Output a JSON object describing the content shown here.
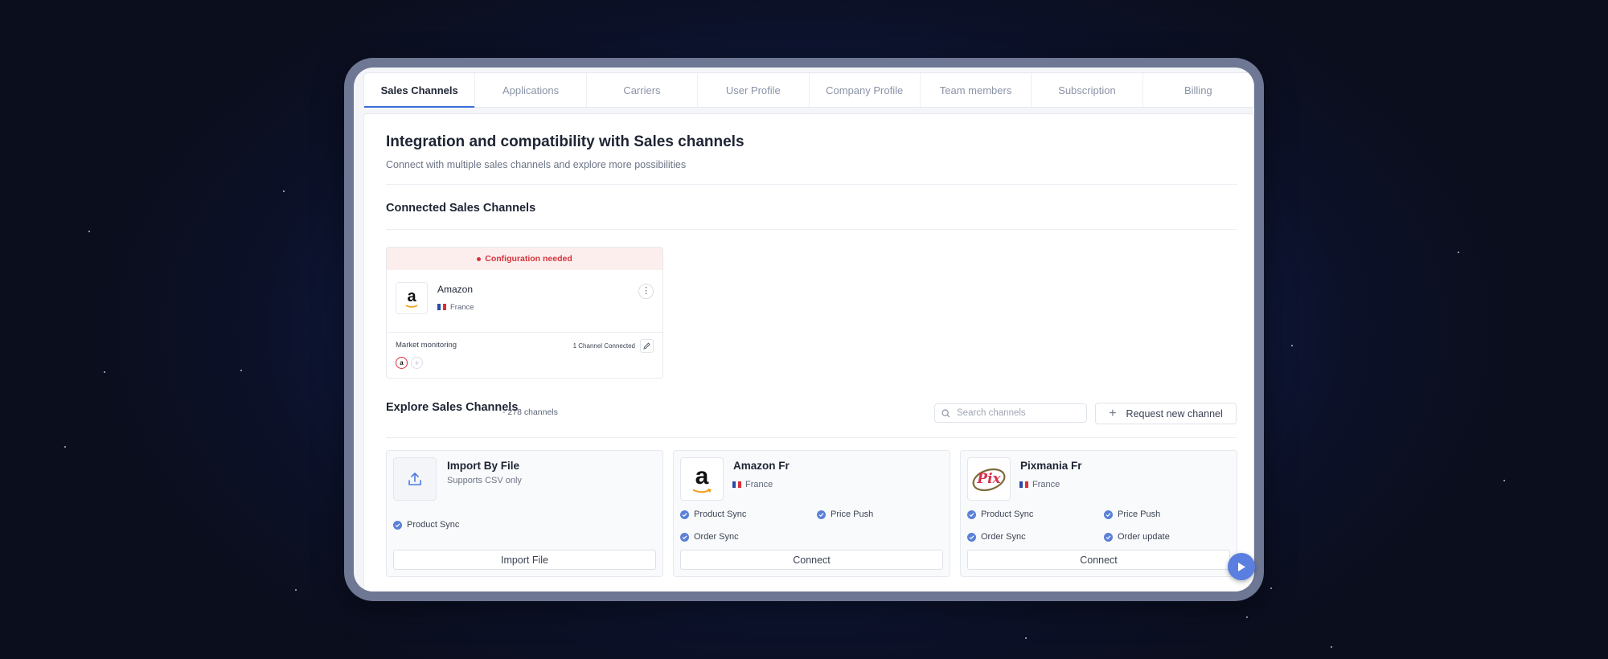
{
  "tabs": [
    {
      "label": "Sales Channels",
      "active": true
    },
    {
      "label": "Applications"
    },
    {
      "label": "Carriers"
    },
    {
      "label": "User Profile"
    },
    {
      "label": "Company Profile"
    },
    {
      "label": "Team members"
    },
    {
      "label": "Subscription"
    },
    {
      "label": "Billing"
    }
  ],
  "page": {
    "title": "Integration and compatibility with Sales channels",
    "subtitle": "Connect with multiple sales channels and explore more possibilities"
  },
  "connected": {
    "heading": "Connected Sales Channels",
    "card": {
      "banner": "Configuration needed",
      "logo_letter": "a",
      "name": "Amazon",
      "country": "France",
      "footer_label": "Market monitoring",
      "connected_count": "1 Channel Connected",
      "avatar_letter": "a",
      "add_symbol": "+"
    }
  },
  "explore": {
    "heading": "Explore Sales Channels",
    "count": "- 278 channels",
    "search_placeholder": "Search channels",
    "request_label": "Request new channel",
    "cards": [
      {
        "name": "Import By File",
        "subtitle": "Supports CSV only",
        "features": [
          "Product Sync"
        ],
        "button": "Import File"
      },
      {
        "name": "Amazon Fr",
        "logo_letter": "a",
        "country": "France",
        "features": [
          "Product Sync",
          "Price Push",
          "Order Sync"
        ],
        "button": "Connect"
      },
      {
        "name": "Pixmania Fr",
        "logo_text": "Pix",
        "country": "France",
        "features": [
          "Product Sync",
          "Price Push",
          "Order Sync",
          "Order update"
        ],
        "button": "Connect"
      }
    ]
  },
  "colors": {
    "accent": "#3b6fd8",
    "warning": "#d4343c",
    "warning_bg": "#fdeeee",
    "check": "#5b80d8",
    "fab": "#5b7fe0"
  }
}
